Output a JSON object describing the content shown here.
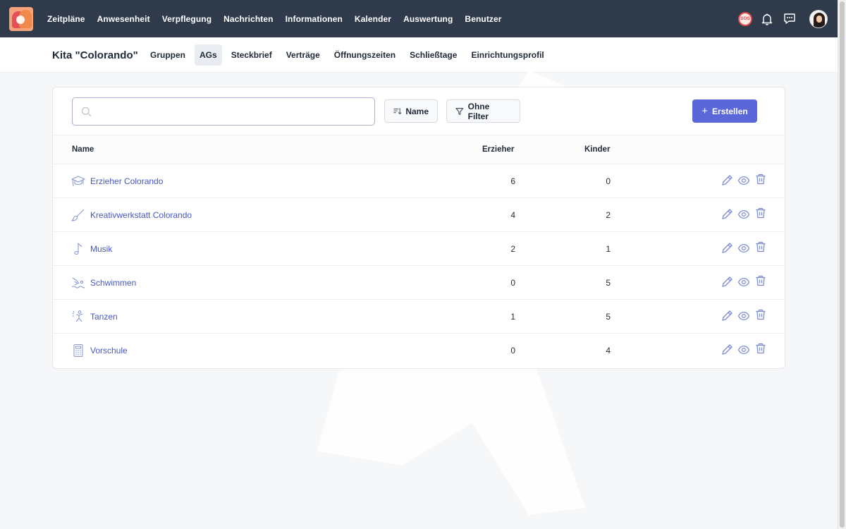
{
  "nav": {
    "items": [
      "Zeitpläne",
      "Anwesenheit",
      "Verpflegung",
      "Nachrichten",
      "Informationen",
      "Kalender",
      "Auswertung",
      "Benutzer"
    ],
    "sos_label": "SOS",
    "icons": [
      "sos-icon",
      "bell-icon",
      "chat-icon",
      "avatar"
    ]
  },
  "subnav": {
    "title": "Kita \"Colorando\"",
    "tabs": [
      "Gruppen",
      "AGs",
      "Steckbrief",
      "Verträge",
      "Öffnungszeiten",
      "Schließtage",
      "Einrichtungsprofil"
    ],
    "active_tab": "AGs"
  },
  "toolbar": {
    "search_value": "",
    "search_placeholder": "",
    "sort_label": "Name",
    "filter_label": "Ohne Filter",
    "create_label": "Erstellen"
  },
  "table": {
    "columns": [
      "Name",
      "Erzieher",
      "Kinder"
    ],
    "rows": [
      {
        "icon": "graduation-cap-icon",
        "name": "Erzieher Colorando",
        "erzieher": "6",
        "kinder": "0"
      },
      {
        "icon": "paintbrush-icon",
        "name": "Kreativwerkstatt Colorando",
        "erzieher": "4",
        "kinder": "2"
      },
      {
        "icon": "music-note-icon",
        "name": "Musik",
        "erzieher": "2",
        "kinder": "1"
      },
      {
        "icon": "swimmer-icon",
        "name": "Schwimmen",
        "erzieher": "0",
        "kinder": "5"
      },
      {
        "icon": "dancer-icon",
        "name": "Tanzen",
        "erzieher": "1",
        "kinder": "5"
      },
      {
        "icon": "calculator-icon",
        "name": "Vorschule",
        "erzieher": "0",
        "kinder": "4"
      }
    ],
    "row_actions": [
      "pencil-icon",
      "eye-icon",
      "trash-icon"
    ]
  },
  "colors": {
    "nav_bg": "#2f3a4a",
    "accent": "#5a67d8",
    "link": "#4856c4",
    "sos": "#e54848"
  }
}
